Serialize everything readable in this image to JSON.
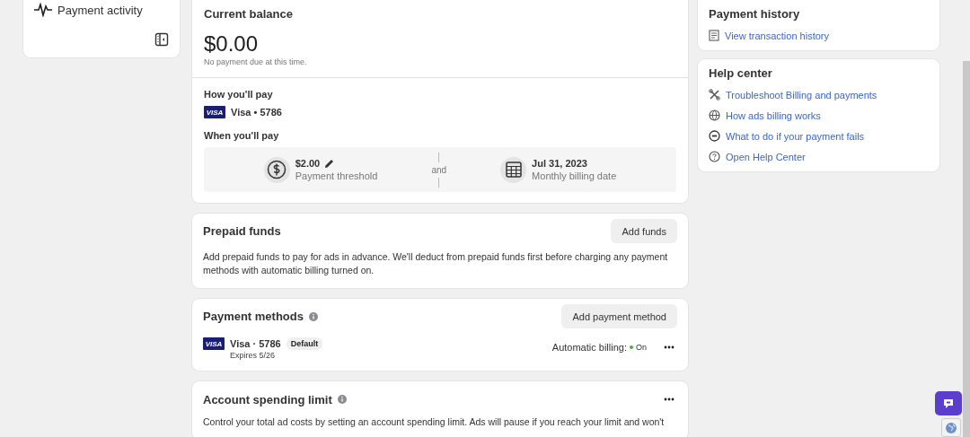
{
  "sidebar": {
    "items": [
      {
        "label": "Payment activity",
        "selected": false
      }
    ]
  },
  "current_balance": {
    "title": "Current balance",
    "amount": "$0.00",
    "note": "No payment due at this time.",
    "how_title": "How you'll pay",
    "card_logo": "VISA",
    "card": "Visa • 5786",
    "when_title": "When you'll pay",
    "threshold_value": "$2.00",
    "threshold_label": "Payment threshold",
    "connector": "and",
    "date_value": "Jul 31, 2023",
    "date_label": "Monthly billing date"
  },
  "prepaid_funds": {
    "title": "Prepaid funds",
    "button": "Add funds",
    "text": "Add prepaid funds to pay for ads in advance. We'll deduct from prepaid funds first before charging any payment methods with automatic billing turned on."
  },
  "payment_methods": {
    "title": "Payment methods",
    "button": "Add payment method",
    "methods": [
      {
        "logo": "VISA",
        "name": "Visa · 5786",
        "badge": "Default",
        "expires": "Expires 5/26",
        "billing_label": "Automatic billing:",
        "billing_state": "On",
        "on": true
      }
    ]
  },
  "spending_limit": {
    "title": "Account spending limit",
    "text": "Control your total ad costs by setting an account spending limit. Ads will pause if you reach your limit and won't"
  },
  "payment_history": {
    "title": "Payment history",
    "links": [
      {
        "kind": "receipt",
        "label": "View transaction history"
      }
    ]
  },
  "help_center": {
    "title": "Help center",
    "links": [
      {
        "kind": "tools",
        "label": "Troubleshoot Billing and payments"
      },
      {
        "kind": "globe",
        "label": "How ads billing works"
      },
      {
        "kind": "minus",
        "label": "What to do if your payment fails"
      },
      {
        "kind": "question",
        "label": "Open Help Center"
      }
    ]
  }
}
